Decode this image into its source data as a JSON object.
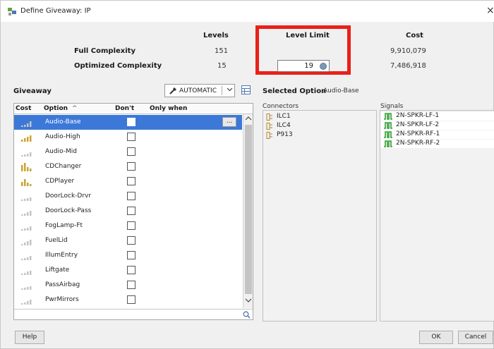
{
  "window": {
    "title": "Define Giveaway: IP",
    "close_glyph": "×"
  },
  "summary": {
    "col_levels": "Levels",
    "col_level_limit": "Level Limit",
    "col_cost": "Cost",
    "rows": [
      {
        "label": "Full Complexity",
        "levels": "151",
        "cost": "9,910,079"
      },
      {
        "label": "Optimized Complexity",
        "levels": "15",
        "limit": "19",
        "cost": "7,486,918"
      }
    ]
  },
  "giveaway": {
    "label": "Giveaway",
    "mode": "AUTOMATIC",
    "columns": {
      "cost": "Cost",
      "option": "Option",
      "sort": "^",
      "dont": "Don't",
      "only_when": "Only when"
    },
    "ellipsis": "...",
    "rows": [
      {
        "option": "Audio-Base",
        "bars": [
          2,
          3,
          5,
          8
        ],
        "selected": true
      },
      {
        "option": "Audio-High",
        "bars": [
          3,
          5,
          7,
          9
        ]
      },
      {
        "option": "Audio-Mid",
        "bars": [
          2,
          3,
          4,
          6
        ]
      },
      {
        "option": "CDChanger",
        "bars": [
          9,
          12,
          6,
          4
        ]
      },
      {
        "option": "CDPlayer",
        "bars": [
          6,
          10,
          5,
          3
        ]
      },
      {
        "option": "DoorLock-Drvr",
        "bars": [
          2,
          3,
          4,
          5
        ]
      },
      {
        "option": "DoorLock-Pass",
        "bars": [
          2,
          3,
          5,
          7
        ]
      },
      {
        "option": "FogLamp-Ft",
        "bars": [
          2,
          3,
          4,
          6
        ]
      },
      {
        "option": "FuelLid",
        "bars": [
          2,
          4,
          6,
          8
        ]
      },
      {
        "option": "IllumEntry",
        "bars": [
          2,
          3,
          4,
          6
        ]
      },
      {
        "option": "Liftgate",
        "bars": [
          2,
          3,
          5,
          6
        ]
      },
      {
        "option": "PassAirbag",
        "bars": [
          2,
          3,
          4,
          5
        ]
      },
      {
        "option": "PwrMirrors",
        "bars": [
          2,
          3,
          5,
          7
        ]
      }
    ]
  },
  "selected_option": {
    "label": "Selected Option",
    "value": "Audio-Base",
    "connectors_label": "Connectors",
    "signals_label": "Signals",
    "connectors": [
      "ILC1",
      "ILC4",
      "P913"
    ],
    "signals": [
      "2N-SPKR-LF-1",
      "2N-SPKR-LF-2",
      "2N-SPKR-RF-1",
      "2N-SPKR-RF-2"
    ]
  },
  "footer": {
    "help": "Help",
    "ok": "OK",
    "cancel": "Cancel"
  },
  "colors": {
    "accent": "#3c78d8",
    "highlight": "#e8211a",
    "cost_bar_high": "#c9a431",
    "cost_bar_low": "#c4c4c4",
    "signal_icon": "#2e9d2e"
  },
  "icons": [
    "app-icon",
    "close-icon",
    "spinner-icon",
    "wand-icon",
    "chevron-down-icon",
    "grid-settings-icon",
    "sort-asc-icon",
    "search-icon",
    "connector-icon",
    "signal-icon",
    "scroll-up-icon",
    "scroll-down-icon"
  ]
}
